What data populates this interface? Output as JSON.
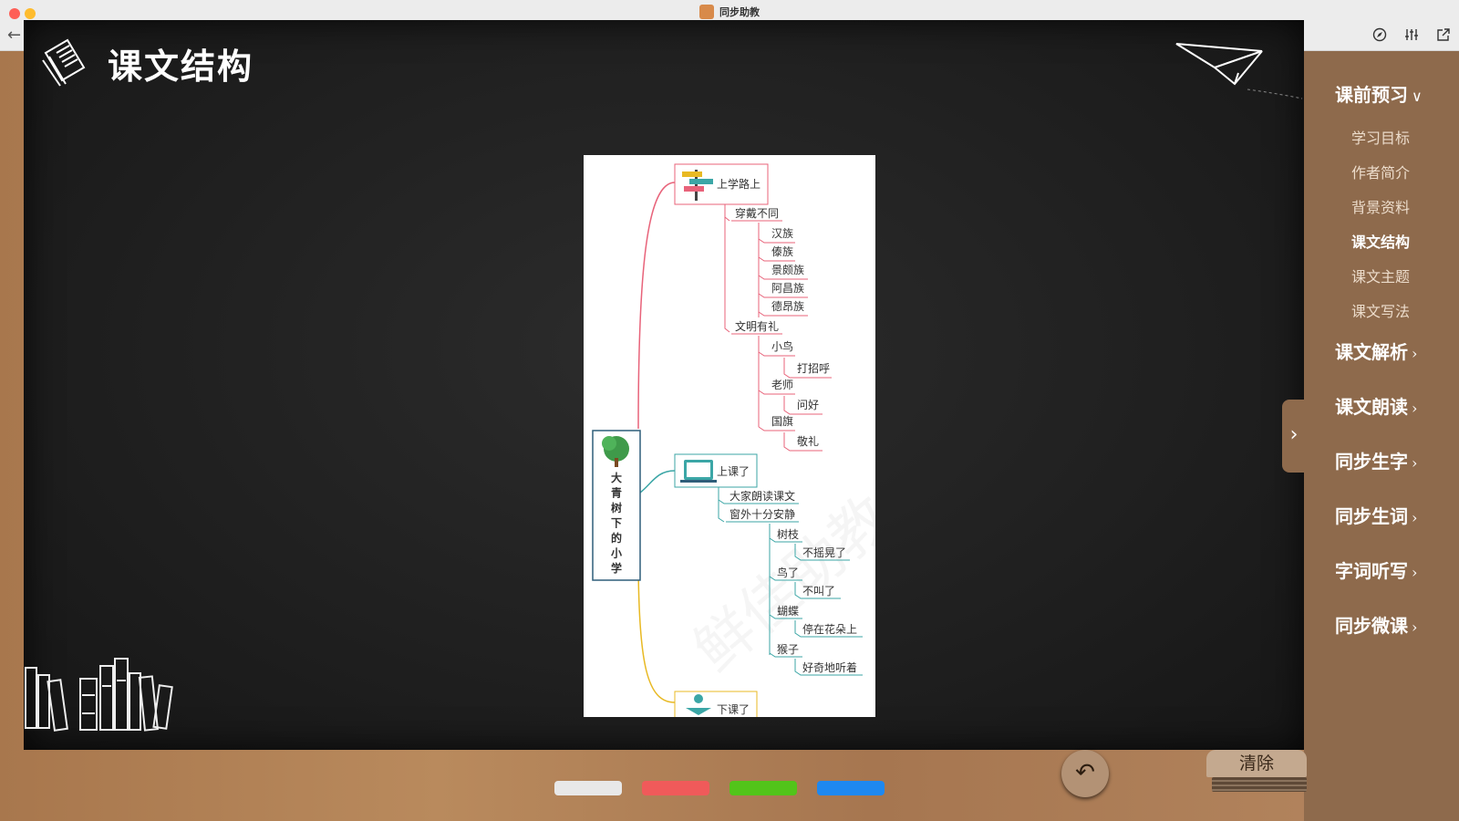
{
  "window": {
    "title": "同步助教"
  },
  "board": {
    "title": "课文结构"
  },
  "sidebar": {
    "sections": [
      {
        "label": "课前预习",
        "expanded": true
      },
      {
        "label": "课文解析",
        "expanded": false
      },
      {
        "label": "课文朗读",
        "expanded": false
      },
      {
        "label": "同步生字",
        "expanded": false
      },
      {
        "label": "同步生词",
        "expanded": false
      },
      {
        "label": "字词听写",
        "expanded": false
      },
      {
        "label": "同步微课",
        "expanded": false
      }
    ],
    "sub_items": [
      "学习目标",
      "作者简介",
      "背景资料",
      "课文结构",
      "课文主题",
      "课文写法"
    ],
    "active_sub_item": "课文结构"
  },
  "mindmap": {
    "root": "大青树下的小学",
    "branch1": {
      "label": "上学路上",
      "color": "#e8637a",
      "children": [
        {
          "label": "穿戴不同",
          "items": [
            "汉族",
            "傣族",
            "景颇族",
            "阿昌族",
            "德昂族"
          ]
        },
        {
          "label": "文明有礼",
          "items": [
            {
              "label": "小鸟",
              "detail": "打招呼"
            },
            {
              "label": "老师",
              "detail": "问好"
            },
            {
              "label": "国旗",
              "detail": "敬礼"
            }
          ]
        }
      ]
    },
    "branch2": {
      "label": "上课了",
      "color": "#3ba6a6",
      "children": [
        {
          "label": "大家朗读课文"
        },
        {
          "label": "窗外十分安静",
          "items": [
            {
              "label": "树枝",
              "detail": "不摇晃了"
            },
            {
              "label": "鸟了",
              "detail": "不叫了"
            },
            {
              "label": "蝴蝶",
              "detail": "停在花朵上"
            },
            {
              "label": "猴子",
              "detail": "好奇地听着"
            }
          ]
        }
      ]
    },
    "branch3": {
      "label": "下课了",
      "color": "#e8b923"
    }
  },
  "chalks": [
    {
      "name": "white",
      "color": "#e8e8e8"
    },
    {
      "name": "red",
      "color": "#f05a5a"
    },
    {
      "name": "green",
      "color": "#52c41a"
    },
    {
      "name": "blue",
      "color": "#1e88f0"
    }
  ],
  "controls": {
    "clear_label": "清除"
  }
}
